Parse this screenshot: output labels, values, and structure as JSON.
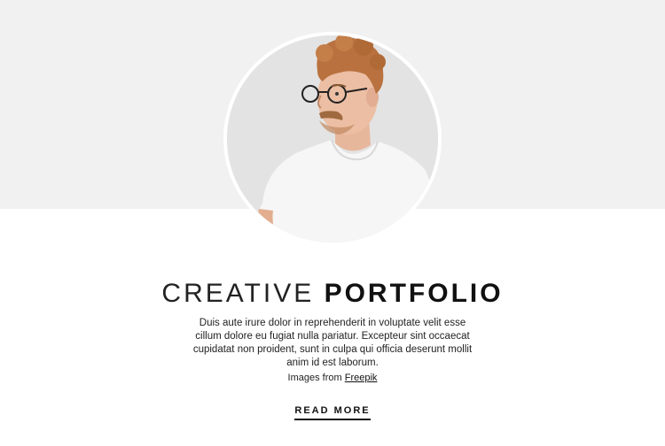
{
  "hero": {
    "image_alt": "Portrait of a man with curly hair and glasses wearing a white t-shirt"
  },
  "headline": {
    "light": "CREATIVE",
    "bold": "PORTFOLIO"
  },
  "description": "Duis aute irure dolor in reprehenderit in voluptate velit esse cillum dolore eu fugiat nulla pariatur. Excepteur sint occaecat cupidatat non proident, sunt in culpa qui officia deserunt mollit anim id est laborum.",
  "credit": {
    "prefix": "Images from",
    "link": "Freepik"
  },
  "cta": {
    "label": "READ MORE"
  },
  "colors": {
    "band": "#f1f1f1",
    "text": "#111111"
  }
}
